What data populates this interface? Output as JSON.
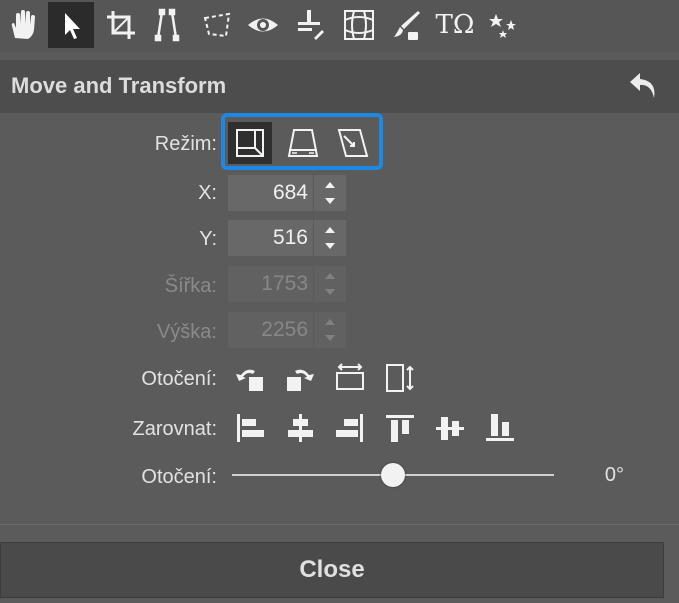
{
  "toolbar": {
    "tools": [
      "hand-icon",
      "select-arrow-icon",
      "crop-icon",
      "straighten-icon",
      "perspective-icon",
      "eye-icon",
      "level-icon",
      "warp-icon",
      "brush-icon",
      "text-icon",
      "effects-stars-icon"
    ],
    "active_tool": "select-arrow-icon",
    "text_tool_glyph": "TΩ"
  },
  "panel": {
    "title": "Move and Transform"
  },
  "mode": {
    "label": "Režim:",
    "options": [
      "move-mode-icon",
      "perspective-mode-icon",
      "skew-mode-icon"
    ],
    "active": "move-mode-icon"
  },
  "fields": {
    "x": {
      "label": "X:",
      "value": "684"
    },
    "y": {
      "label": "Y:",
      "value": "516"
    },
    "width": {
      "label": "Šířka:",
      "value": "1753"
    },
    "height": {
      "label": "Výška:",
      "value": "2256"
    }
  },
  "rotation_buttons": {
    "label": "Otočení:",
    "icons": [
      "rotate-left-icon",
      "rotate-right-icon",
      "flip-horizontal-icon",
      "flip-vertical-icon"
    ]
  },
  "align": {
    "label": "Zarovnat:",
    "icons": [
      "align-left-icon",
      "align-center-horizontal-icon",
      "align-right-icon",
      "align-top-icon",
      "align-center-vertical-icon",
      "align-bottom-icon"
    ]
  },
  "rotation_slider": {
    "label": "Otočení:",
    "value_text": "0°",
    "value_fraction": 0.5
  },
  "close_label": "Close",
  "colors": {
    "accent": "#1e88e5",
    "background": "#5b5b5b"
  }
}
